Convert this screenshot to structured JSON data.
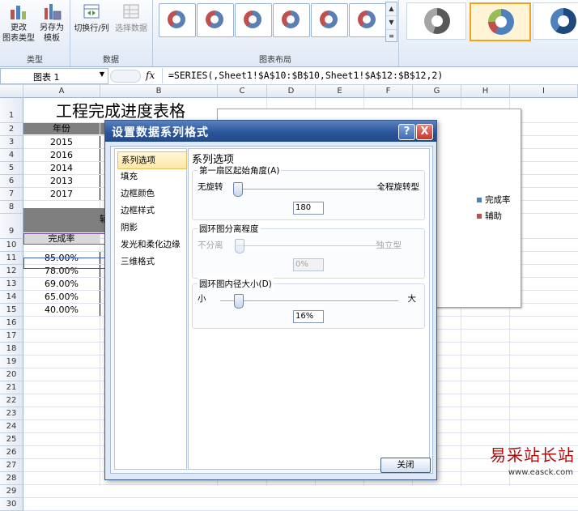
{
  "ribbon": {
    "type_group": {
      "label": "类型",
      "buttons": [
        {
          "label": "更改图表类型",
          "line1": "更改",
          "line2": "图表类型",
          "icon": "chart-bar-icon"
        },
        {
          "label": "另存为模板",
          "line1": "另存为",
          "line2": "模板",
          "icon": "save-template-icon"
        }
      ]
    },
    "data_group": {
      "label": "数据",
      "switch_label": "切换行/列",
      "select_label": "选择数据"
    },
    "layout_group": {
      "label": "图表布局",
      "thumb_count": 6
    },
    "styles": [
      "gray-donut",
      "blue-red-donut-selected",
      "blue-donut"
    ]
  },
  "formula_bar": {
    "name_box": "图表 1",
    "fx": "fx",
    "formula": "=SERIES(,Sheet1!$A$10:$B$10,Sheet1!$A$12:$B$12,2)"
  },
  "grid": {
    "columns": [
      "A",
      "B",
      "C",
      "D",
      "E",
      "F",
      "G",
      "H",
      "I"
    ],
    "rows": [
      "1",
      "2",
      "3",
      "4",
      "5",
      "6",
      "7",
      "8",
      "9",
      "10",
      "11",
      "12",
      "13",
      "14",
      "15",
      "16",
      "17",
      "18",
      "19",
      "20",
      "21",
      "22",
      "23",
      "24",
      "25",
      "26",
      "27",
      "28",
      "29",
      "30"
    ],
    "title": "工程完成进度表格",
    "year_header": "年份",
    "years": [
      "2015",
      "2016",
      "2014",
      "2013",
      "2017"
    ],
    "b9_partial": "辅",
    "rate_header": "完成率",
    "rates": [
      "85.00%",
      "78.00%",
      "69.00%",
      "65.00%",
      "40.00%"
    ]
  },
  "chart": {
    "legend": [
      {
        "label": "完成率",
        "color": "#4f81bd"
      },
      {
        "label": "辅助",
        "color": "#c0504d"
      }
    ]
  },
  "dialog": {
    "title": "设置数据系列格式",
    "help": "?",
    "close": "X",
    "nav": [
      "系列选项",
      "填充",
      "边框颜色",
      "边框样式",
      "阴影",
      "发光和柔化边缘",
      "三维格式"
    ],
    "selected_nav": "系列选项",
    "panel_title": "系列选项",
    "angle": {
      "title": "第一扇区起始角度(A)",
      "min_label": "无旋转",
      "max_label": "全程旋转型",
      "value": "180",
      "position": 0.0
    },
    "explosion": {
      "title": "圆环图分离程度",
      "min_label": "不分离",
      "max_label": "独立型",
      "value": "0%",
      "position": 0.0
    },
    "hole": {
      "title": "圆环图内径大小(D)",
      "min_label": "小",
      "max_label": "大",
      "value": "16%",
      "position": 0.1
    },
    "close_button": "关闭"
  },
  "watermark": {
    "line1": "易采站长站",
    "line2": "www.easck.com"
  }
}
